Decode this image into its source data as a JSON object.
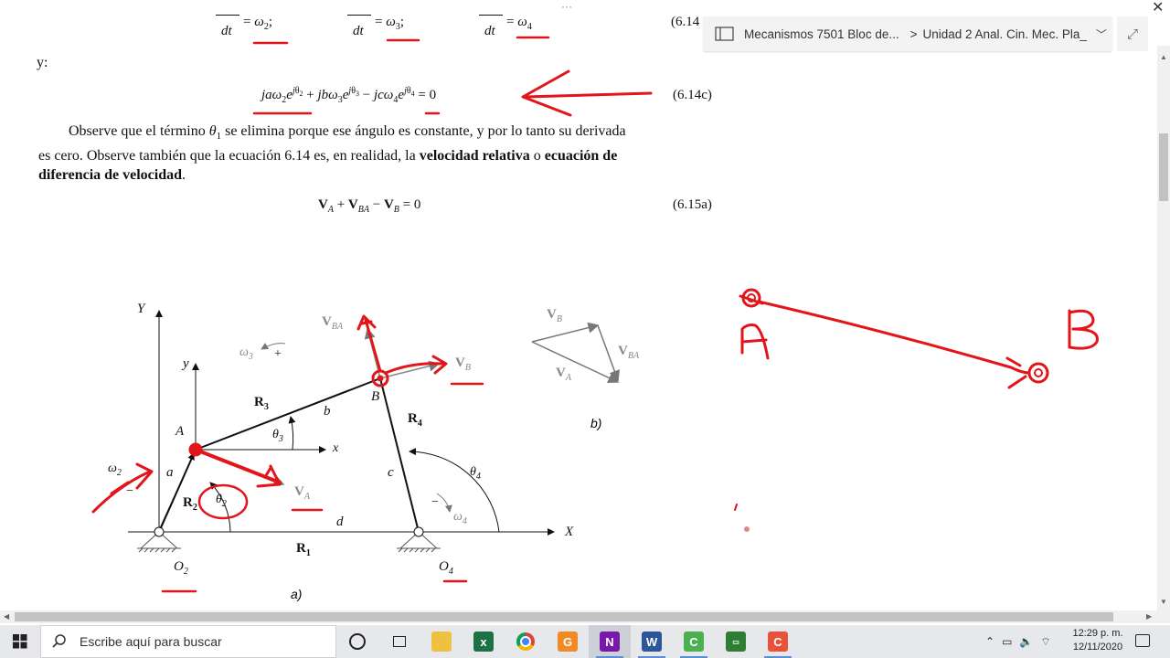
{
  "topbar": {
    "dots": "···",
    "close_label": "✕"
  },
  "document": {
    "eq_top": {
      "dt1": "dt",
      "w2": "ω",
      "sub2": "2",
      "dt2": "dt",
      "w3": "ω",
      "sub3": "3",
      "dt3": "dt",
      "w4": "ω",
      "sub4": "4",
      "number": "(6.14"
    },
    "y_label": "y:",
    "eq_c": {
      "number": "(6.14c)",
      "rhs": "= 0"
    },
    "paragraph": {
      "l1a": "Observe que el término ",
      "theta1": "θ",
      "theta1_sub": "1",
      "l1b": " se elimina porque ese ángulo es constante, y por lo tanto su derivada",
      "l2a": "es cero. Observe también que la ecuación 6.14 es, en realidad, la ",
      "bold1": "velocidad relativa",
      "l2b": " o ",
      "bold2": "ecuación de",
      "bold3": "diferencia de velocidad",
      "l3b": "."
    },
    "eq_a": {
      "number": "(6.15a)",
      "rhs": "= 0"
    }
  },
  "figure": {
    "Y": "Y",
    "y": "y",
    "X": "X",
    "x": "x",
    "A": "A",
    "B": "B",
    "R1": "R",
    "R2": "R",
    "R3": "R",
    "R4": "R",
    "a": "a",
    "b": "b",
    "c": "c",
    "d": "d",
    "theta2": "θ",
    "theta3": "θ",
    "theta4": "θ",
    "omega2": "ω",
    "omega3": "ω",
    "omega4": "ω",
    "VA": "V",
    "VB": "V",
    "VBA": "V",
    "O2": "O",
    "O4": "O",
    "caption_a": "a)",
    "caption_b": "b)",
    "sub_A": "A",
    "sub_B": "B",
    "sub_BA": "BA",
    "sub_1": "1",
    "sub_2": "2",
    "sub_3": "3",
    "sub_4": "4",
    "plus": "+",
    "minus": "−"
  },
  "handwriting": {
    "A": "A",
    "B": "B"
  },
  "colors": {
    "ink": "#e3151a",
    "gray": "#7a7a7a"
  },
  "breadcrumb": {
    "notebook": "Mecanismos 7501 Bloc de...",
    "separator": ">",
    "section": "Unidad 2 Anal. Cin. Mec. Pla_"
  },
  "taskbar": {
    "search_placeholder": "Escribe aquí para buscar",
    "time": "12:29 p. m.",
    "date": "12/11/2020",
    "apps": [
      "cortana",
      "task-view",
      "file-explorer",
      "excel",
      "chrome",
      "foxit",
      "onenote",
      "word",
      "camtasia-recorder",
      "meeting-app",
      "camtasia"
    ]
  }
}
